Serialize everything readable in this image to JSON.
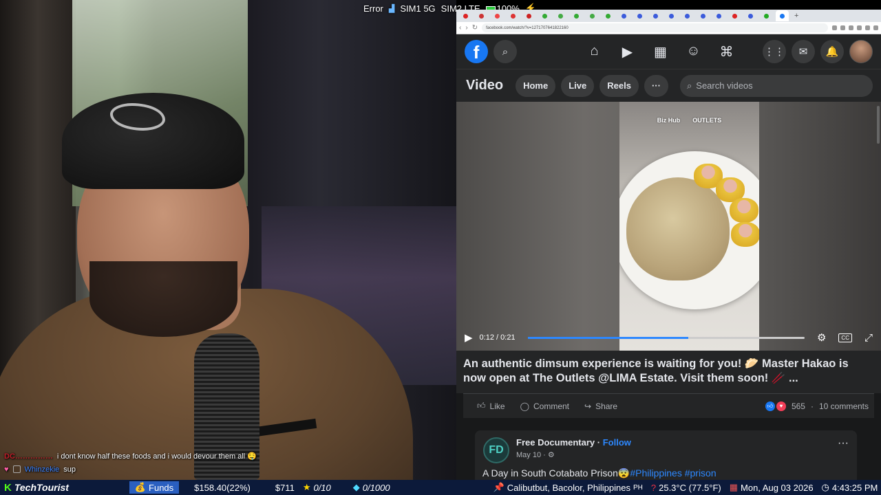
{
  "status_bar": {
    "error": "Error",
    "sim1": "SIM1 5G",
    "sim2": "SIM2 LTE",
    "battery": "100%"
  },
  "browser": {
    "url": "facebook.com/watch/?v=1271707641822160"
  },
  "facebook": {
    "section_title": "Video",
    "nav_pills": [
      "Home",
      "Live",
      "Reels"
    ],
    "search_placeholder": "Search videos",
    "video": {
      "brand_left": "Biz Hub",
      "brand_right": "OUTLETS",
      "time_current": "0:12",
      "time_total": "0:21",
      "progress": 0.58
    },
    "caption": "An authentic dimsum experience is waiting for you! 🥟 Master Hakao is now open at The Outlets @LIMA Estate. Visit them soon! 🥢 ...",
    "actions": {
      "like": "Like",
      "comment": "Comment",
      "share": "Share",
      "reactions": "565",
      "comments": "10 comments"
    },
    "post": {
      "page_name": "Free Documentary",
      "follow": "Follow",
      "date": "May 10 ·",
      "text": "A Day in South Cotabato Prison😨",
      "tags": "#Philippines #prison"
    }
  },
  "chat": [
    {
      "user": "DC……………",
      "message": "i dont know half these foods and i would devour them all 🤤"
    },
    {
      "user": "Whinzekie",
      "message": "sup"
    }
  ],
  "ticker": {
    "channel": "TechTourist",
    "funds_label": "Funds",
    "funds_value": "$158.40(22%)",
    "goal": "$711",
    "stars": "0/10",
    "gems": "0/1000",
    "location": "Calibutbut, Bacolor, Philippines",
    "country": "PH",
    "weather": "25.3°C (77.5°F)",
    "date": "Mon, Aug 03 2026",
    "time": "4:43:25 PM"
  },
  "colors": {
    "fb_blue": "#1877f2",
    "fb_bg": "#18191a",
    "ticker_bg": "#0c1a3a",
    "kick_green": "#53fc18"
  }
}
